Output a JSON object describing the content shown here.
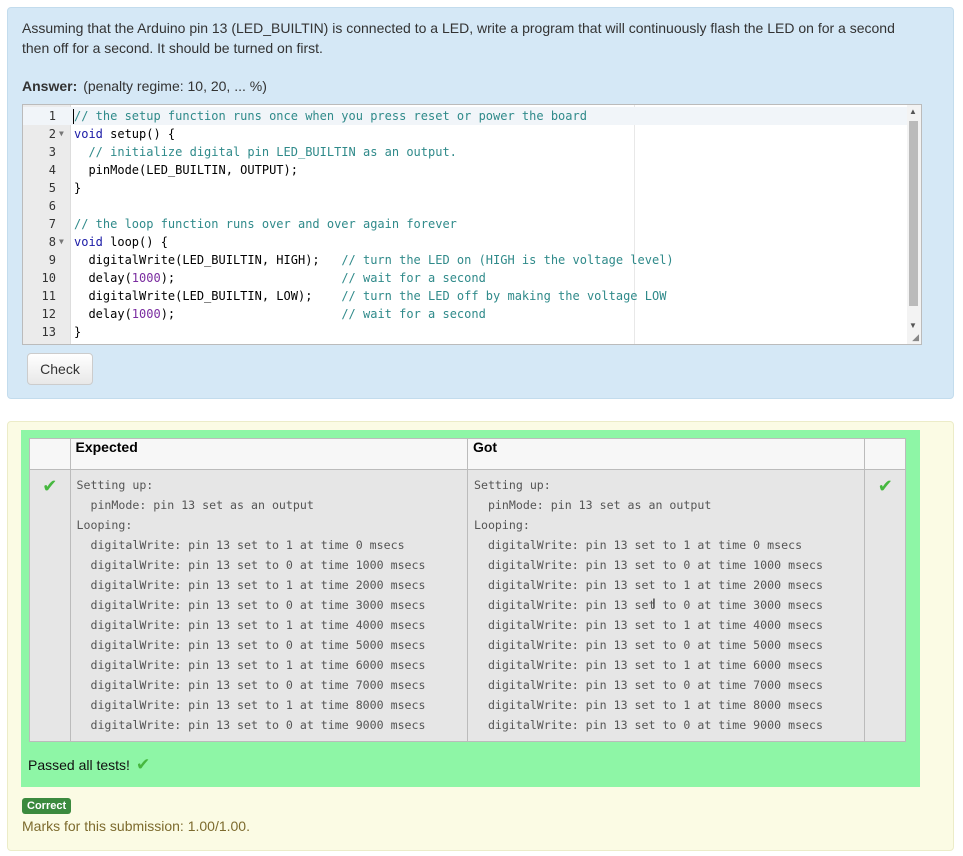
{
  "question": {
    "text": "Assuming that the Arduino pin 13 (LED_BUILTIN) is connected to a LED, write a program that will continuously flash the LED on for a second then off for a second. It should be turned on first.",
    "answer_label": "Answer:",
    "penalty_regime": "(penalty regime: 10, 20, ... %)"
  },
  "editor": {
    "lines": [
      {
        "num": "1",
        "fold": false,
        "segments": [
          {
            "t": "// the setup function runs once when you press reset or power the board",
            "c": "com"
          }
        ]
      },
      {
        "num": "2",
        "fold": true,
        "segments": [
          {
            "t": "void",
            "c": "key"
          },
          {
            "t": " setup() {",
            "c": ""
          }
        ]
      },
      {
        "num": "3",
        "fold": false,
        "segments": [
          {
            "t": "  // initialize digital pin LED_BUILTIN as an output.",
            "c": "com"
          }
        ]
      },
      {
        "num": "4",
        "fold": false,
        "segments": [
          {
            "t": "  pinMode(LED_BUILTIN, OUTPUT);",
            "c": ""
          }
        ]
      },
      {
        "num": "5",
        "fold": false,
        "segments": [
          {
            "t": "}",
            "c": ""
          }
        ]
      },
      {
        "num": "6",
        "fold": false,
        "segments": [
          {
            "t": "",
            "c": ""
          }
        ]
      },
      {
        "num": "7",
        "fold": false,
        "segments": [
          {
            "t": "// the loop function runs over and over again forever",
            "c": "com"
          }
        ]
      },
      {
        "num": "8",
        "fold": true,
        "segments": [
          {
            "t": "void",
            "c": "key"
          },
          {
            "t": " loop() {",
            "c": ""
          }
        ]
      },
      {
        "num": "9",
        "fold": false,
        "segments": [
          {
            "t": "  digitalWrite(LED_BUILTIN, HIGH);   ",
            "c": ""
          },
          {
            "t": "// turn the LED on (HIGH is the voltage level)",
            "c": "com"
          }
        ]
      },
      {
        "num": "10",
        "fold": false,
        "segments": [
          {
            "t": "  delay(",
            "c": ""
          },
          {
            "t": "1000",
            "c": "num"
          },
          {
            "t": ");                       ",
            "c": ""
          },
          {
            "t": "// wait for a second",
            "c": "com"
          }
        ]
      },
      {
        "num": "11",
        "fold": false,
        "segments": [
          {
            "t": "  digitalWrite(LED_BUILTIN, LOW);    ",
            "c": ""
          },
          {
            "t": "// turn the LED off by making the voltage LOW",
            "c": "com"
          }
        ]
      },
      {
        "num": "12",
        "fold": false,
        "segments": [
          {
            "t": "  delay(",
            "c": ""
          },
          {
            "t": "1000",
            "c": "num"
          },
          {
            "t": ");                       ",
            "c": ""
          },
          {
            "t": "// wait for a second",
            "c": "com"
          }
        ]
      },
      {
        "num": "13",
        "fold": false,
        "segments": [
          {
            "t": "}",
            "c": ""
          }
        ]
      }
    ]
  },
  "check_button": "Check",
  "results": {
    "headers": {
      "expected": "Expected",
      "got": "Got"
    },
    "expected": "Setting up:\n  pinMode: pin 13 set as an output\nLooping:\n  digitalWrite: pin 13 set to 1 at time 0 msecs\n  digitalWrite: pin 13 set to 0 at time 1000 msecs\n  digitalWrite: pin 13 set to 1 at time 2000 msecs\n  digitalWrite: pin 13 set to 0 at time 3000 msecs\n  digitalWrite: pin 13 set to 1 at time 4000 msecs\n  digitalWrite: pin 13 set to 0 at time 5000 msecs\n  digitalWrite: pin 13 set to 1 at time 6000 msecs\n  digitalWrite: pin 13 set to 0 at time 7000 msecs\n  digitalWrite: pin 13 set to 1 at time 8000 msecs\n  digitalWrite: pin 13 set to 0 at time 9000 msecs",
    "got": "Setting up:\n  pinMode: pin 13 set as an output\nLooping:\n  digitalWrite: pin 13 set to 1 at time 0 msecs\n  digitalWrite: pin 13 set to 0 at time 1000 msecs\n  digitalWrite: pin 13 set to 1 at time 2000 msecs\n  digitalWrite: pin 13 set to 0 at time 3000 msecs\n  digitalWrite: pin 13 set to 1 at time 4000 msecs\n  digitalWrite: pin 13 set to 0 at time 5000 msecs\n  digitalWrite: pin 13 set to 1 at time 6000 msecs\n  digitalWrite: pin 13 set to 0 at time 7000 msecs\n  digitalWrite: pin 13 set to 1 at time 8000 msecs\n  digitalWrite: pin 13 set to 0 at time 9000 msecs",
    "tick": "✔",
    "passed_text": "Passed all tests!"
  },
  "outcome": {
    "badge": "Correct",
    "marks": "Marks for this submission: 1.00/1.00."
  },
  "colors": {
    "question_bg": "#d5e8f6",
    "results_bg": "#fbfbe4",
    "pass_green": "#8ef6a6",
    "badge_green": "#3b8a3e"
  }
}
